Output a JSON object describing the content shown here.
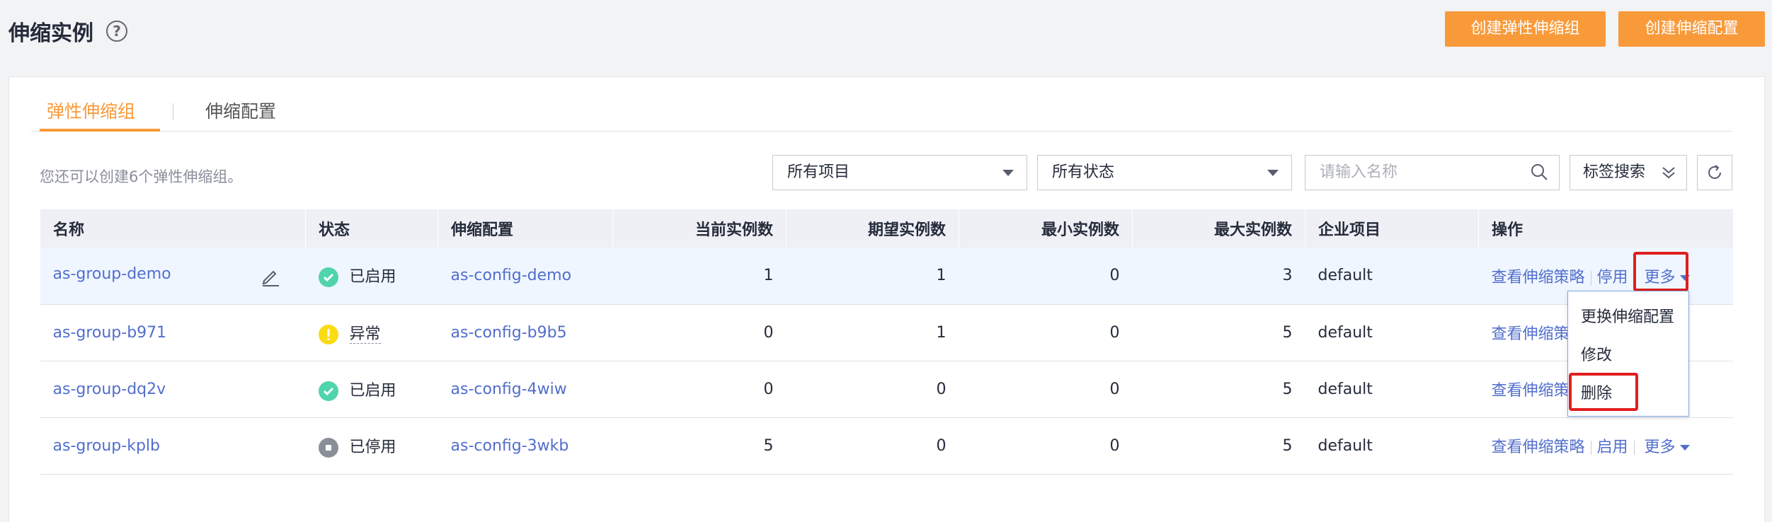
{
  "header": {
    "title": "伸缩实例",
    "help_symbol": "?",
    "create_group_label": "创建弹性伸缩组",
    "create_config_label": "创建伸缩配置"
  },
  "tabs": [
    {
      "label": "弹性伸缩组",
      "active": true
    },
    {
      "label": "伸缩配置",
      "active": false
    }
  ],
  "toolbar": {
    "quota_text": "您还可以创建6个弹性伸缩组。",
    "project_select": "所有项目",
    "status_select": "所有状态",
    "search_placeholder": "请输入名称",
    "tag_search_label": "标签搜索"
  },
  "table": {
    "columns": [
      "名称",
      "状态",
      "伸缩配置",
      "当前实例数",
      "期望实例数",
      "最小实例数",
      "最大实例数",
      "企业项目",
      "操作"
    ],
    "rows": [
      {
        "name": "as-group-demo",
        "status": "已启用",
        "status_type": "ok",
        "config": "as-config-demo",
        "current": "1",
        "desired": "1",
        "min": "0",
        "max": "3",
        "project": "default",
        "op1": "查看伸缩策略",
        "op2": "停用",
        "op3": "更多"
      },
      {
        "name": "as-group-b971",
        "status": "异常",
        "status_type": "warn",
        "config": "as-config-b9b5",
        "current": "0",
        "desired": "1",
        "min": "0",
        "max": "5",
        "project": "default",
        "op1": "查看伸缩策",
        "op2": "",
        "op3": ""
      },
      {
        "name": "as-group-dq2v",
        "status": "已启用",
        "status_type": "ok",
        "config": "as-config-4wiw",
        "current": "0",
        "desired": "0",
        "min": "0",
        "max": "5",
        "project": "default",
        "op1": "查看伸缩策",
        "op2": "",
        "op3": ""
      },
      {
        "name": "as-group-kplb",
        "status": "已停用",
        "status_type": "stop",
        "config": "as-config-3wkb",
        "current": "5",
        "desired": "0",
        "min": "0",
        "max": "5",
        "project": "default",
        "op1": "查看伸缩策略",
        "op2": "启用",
        "op3": "更多"
      }
    ]
  },
  "dropdown": {
    "items": [
      "更换伸缩配置",
      "修改",
      "删除"
    ]
  },
  "colors": {
    "accent": "#f99a3a",
    "link": "#526ecc",
    "ok": "#50d4ab",
    "warn": "#fadb14",
    "stopped": "#8a8e99",
    "highlight_outline": "#e01e1e"
  }
}
